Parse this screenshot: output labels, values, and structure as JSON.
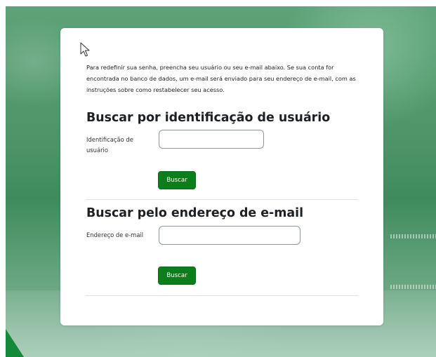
{
  "page": {
    "intro_text": "Para redefinir sua senha, preencha seu usuário ou seu e-mail abaixo. Se sua conta for encontrada no banco de dados, um e-mail será enviado para seu endereço de e-mail, com as instruções sobre como restabelecer seu acesso."
  },
  "username_section": {
    "heading": "Buscar por identificação de usuário",
    "field_label": "Identificação de usuário",
    "field_value": "",
    "button_label": "Buscar"
  },
  "email_section": {
    "heading": "Buscar pelo endereço de e-mail",
    "field_label": "Endereço de e-mail",
    "field_value": "",
    "button_label": "Buscar"
  },
  "icons": {
    "cursor": "mouse-pointer-icon"
  },
  "colors": {
    "button_bg": "#0b7d1a",
    "background_green": "#4c9468",
    "card_bg": "#ffffff",
    "heading_text": "#1d2125"
  }
}
